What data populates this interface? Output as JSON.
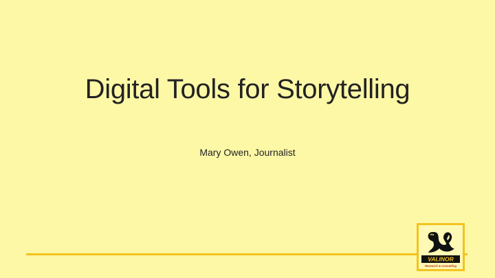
{
  "slide": {
    "title": "Digital Tools for Storytelling",
    "subtitle": "Mary Owen, Journalist"
  },
  "logo": {
    "name": "VALINOR",
    "tagline": "Research & Consulting",
    "icon": "swan-icon"
  },
  "colors": {
    "background": "#fdf8a6",
    "accent": "#f4c21f",
    "text": "#222222"
  }
}
